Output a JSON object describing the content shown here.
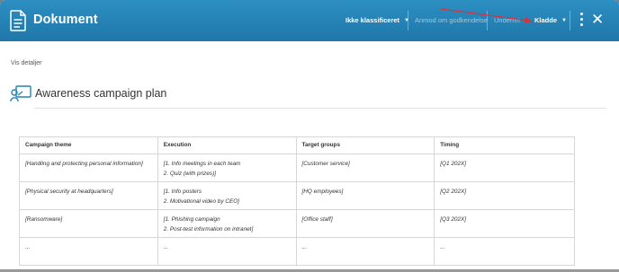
{
  "header": {
    "title": "Dokument",
    "classification_label": "Ikke klassificeret",
    "request_approval_label": "Anmod om godkendelse",
    "notify_label": "Underret",
    "status_label": "Kladde",
    "accent_color": "#2384b7"
  },
  "details": {
    "show_details_label": "Vis detaljer"
  },
  "plan": {
    "title": "Awareness campaign plan"
  },
  "table": {
    "headers": [
      "Campaign theme",
      "Execution",
      "Target groups",
      "Timing"
    ],
    "rows": [
      {
        "theme": "[Handling and protecting personal information]",
        "execution_1": "[1. Info meetings in each team",
        "execution_2": "2. Quiz (with prizes)]",
        "target": "[Customer service]",
        "timing": "[Q1 202X]"
      },
      {
        "theme": "[Physical security at headquarters]",
        "execution_1": "[1. Info posters",
        "execution_2": "2. Motivational video by CEO]",
        "target": "[HQ employees]",
        "timing": "[Q2 202X]"
      },
      {
        "theme": "[Ransomware]",
        "execution_1": "[1. Phishing campaign",
        "execution_2": "2. Post-test information on intranet]",
        "target": "[Office staff]",
        "timing": "[Q3 202X]"
      },
      {
        "theme": "...",
        "execution_1": "...",
        "execution_2": "",
        "target": "...",
        "timing": "..."
      }
    ]
  }
}
